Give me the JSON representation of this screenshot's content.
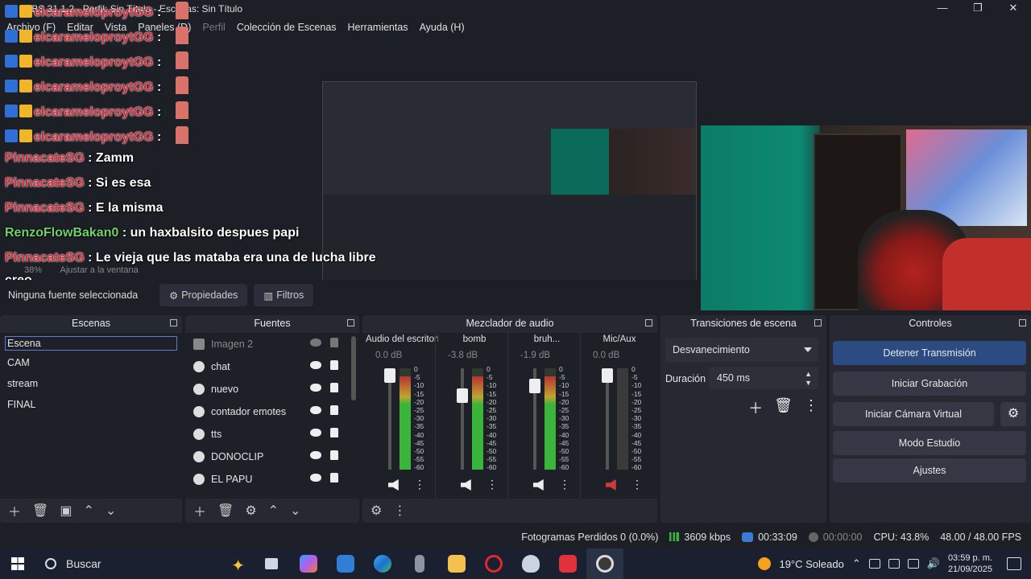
{
  "window": {
    "title": "OBS 31.1.2 - Perfil: Sin Título - Escenas: Sin Título",
    "minimize": "—",
    "maximize": "❐",
    "close": "✕"
  },
  "menu": [
    "Archivo (F)",
    "Editar",
    "Vista",
    "Paneles (D)",
    "Perfil",
    "Colección de Escenas",
    "Herramientas",
    "Ayuda (H)"
  ],
  "chat": {
    "messages": [
      {
        "user": "elcarameloproytGG",
        "text": ":",
        "color": "#d72b3a",
        "badges": true
      },
      {
        "user": "elcarameloproytGG",
        "text": ":",
        "color": "#d72b3a",
        "badges": true
      },
      {
        "user": "elcarameloproytGG",
        "text": ":",
        "color": "#d72b3a",
        "badges": true
      },
      {
        "user": "elcarameloproytGG",
        "text": ":",
        "color": "#d72b3a",
        "badges": true
      },
      {
        "user": "elcarameloproytGG",
        "text": ":",
        "color": "#d72b3a",
        "badges": true
      },
      {
        "user": "elcarameloproytGG",
        "text": ":",
        "color": "#d72b3a",
        "badges": true
      },
      {
        "user": "PinnacateSG",
        "text": ": Zamm",
        "color": "#d72b3a",
        "badges": false
      },
      {
        "user": "PinnacateSG",
        "text": ": Si es esa",
        "color": "#d72b3a",
        "badges": false
      },
      {
        "user": "PinnacateSG",
        "text": ": E la misma",
        "color": "#d72b3a",
        "badges": false
      },
      {
        "user": "RenzoFlowBakan0",
        "text": ": un haxbalsito despues papi",
        "color": "#6fd36a",
        "badges": false
      },
      {
        "user": "PinnacateSG",
        "text": ": Le vieja que las mataba era una de lucha libre",
        "color": "#d72b3a",
        "badges": false
      }
    ],
    "continuation": "creo"
  },
  "preview_bar": {
    "zoom": "38%",
    "fit": "Ajustar a la ventana"
  },
  "properties_bar": {
    "selection": "Ninguna fuente seleccionada",
    "properties_label": "Propiedades",
    "filters_label": "Filtros"
  },
  "scenes": {
    "title": "Escenas",
    "items": [
      "Escena",
      "CAM",
      "stream",
      "FINAL"
    ],
    "active_index": 0
  },
  "sources": {
    "title": "Fuentes",
    "items": [
      {
        "name": "Imagen 2",
        "visible": false,
        "locked": true,
        "icon": "image-icon"
      },
      {
        "name": "chat",
        "visible": true,
        "locked": true,
        "icon": "browser-icon"
      },
      {
        "name": "nuevo",
        "visible": true,
        "locked": true,
        "icon": "browser-icon"
      },
      {
        "name": "contador emotes",
        "visible": true,
        "locked": true,
        "icon": "browser-icon"
      },
      {
        "name": "tts",
        "visible": true,
        "locked": true,
        "icon": "browser-icon"
      },
      {
        "name": "DONOCLIP",
        "visible": true,
        "locked": true,
        "icon": "browser-icon"
      },
      {
        "name": "EL PAPU",
        "visible": true,
        "locked": true,
        "icon": "gamepad-icon"
      }
    ]
  },
  "mixer": {
    "title": "Mezclador de audio",
    "scale": [
      "0",
      "-5",
      "-10",
      "-15",
      "-20",
      "-25",
      "-30",
      "-35",
      "-40",
      "-45",
      "-50",
      "-55",
      "-60"
    ],
    "channels": [
      {
        "name": "Audio del escritorio",
        "db": "0.0 dB",
        "level": 1.0,
        "meter": 0.92,
        "muted": false
      },
      {
        "name": "bomb",
        "db": "-3.8 dB",
        "level": 0.77,
        "meter": 0.92,
        "muted": false
      },
      {
        "name": "bruh...",
        "db": "-1.9 dB",
        "level": 0.88,
        "meter": 0.92,
        "muted": false
      },
      {
        "name": "Mic/Aux",
        "db": "0.0 dB",
        "level": 1.0,
        "meter": 0.0,
        "muted": true
      }
    ]
  },
  "transitions": {
    "title": "Transiciones de escena",
    "selected": "Desvanecimiento",
    "duration_label": "Duración",
    "duration_value": "450 ms"
  },
  "controls": {
    "title": "Controles",
    "buttons": [
      "Detener Transmisión",
      "Iniciar Grabación",
      "Iniciar Cámara Virtual",
      "Modo Estudio",
      "Ajustes"
    ]
  },
  "status": {
    "dropped": "Fotogramas Perdidos 0 (0.0%)",
    "bitrate": "3609 kbps",
    "live_time": "00:33:09",
    "rec_time": "00:00:00",
    "cpu": "CPU: 43.8%",
    "fps": "48.00 / 48.00 FPS"
  },
  "taskbar": {
    "search_placeholder": "Buscar",
    "weather": "19°C  Soleado",
    "time": "03:59 p. m.",
    "date": "21/09/2025"
  },
  "colors": {
    "accent": "#2d4b83",
    "chat_red": "#d72b3a",
    "chat_green": "#6fd36a"
  }
}
